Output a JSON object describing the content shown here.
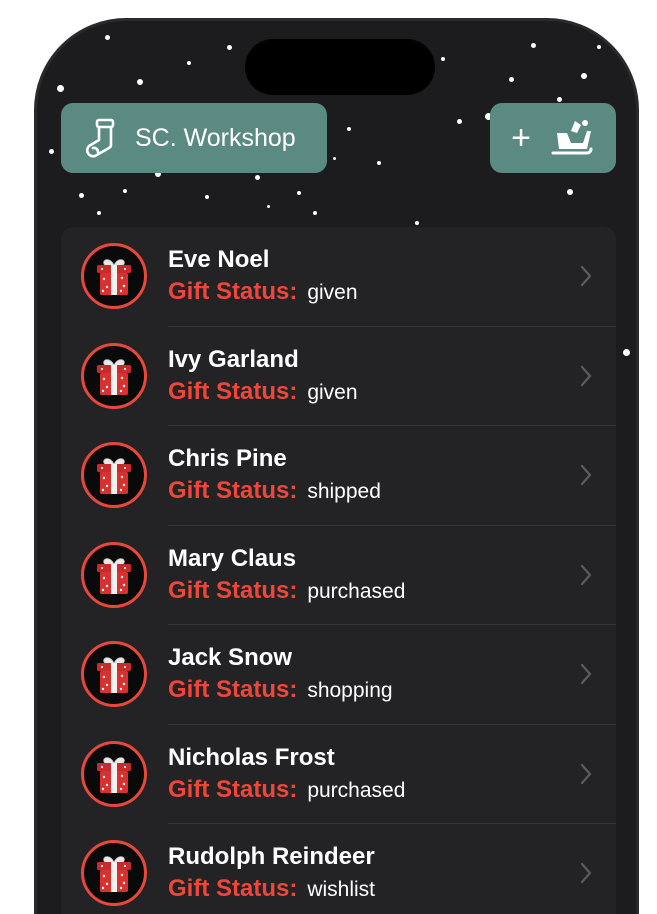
{
  "header": {
    "workshop_label": "SC. Workshop",
    "workshop_icon": "stocking-icon",
    "add_label": "+",
    "add_icon": "sleigh-icon"
  },
  "colors": {
    "background": "#1c1c1e",
    "button": "#5a8a82",
    "status_label": "#f0463a",
    "avatar_ring": "#e8483c"
  },
  "recipients": [
    {
      "name": "Eve Noel",
      "status_label": "Gift Status:",
      "status": "given"
    },
    {
      "name": "Ivy Garland",
      "status_label": "Gift Status:",
      "status": "given"
    },
    {
      "name": "Chris Pine",
      "status_label": "Gift Status:",
      "status": "shipped"
    },
    {
      "name": "Mary Claus",
      "status_label": "Gift Status:",
      "status": "purchased"
    },
    {
      "name": "Jack Snow",
      "status_label": "Gift Status:",
      "status": "shopping"
    },
    {
      "name": "Nicholas Frost",
      "status_label": "Gift Status:",
      "status": "purchased"
    },
    {
      "name": "Rudolph Reindeer",
      "status_label": "Gift Status:",
      "status": "wishlist"
    }
  ]
}
